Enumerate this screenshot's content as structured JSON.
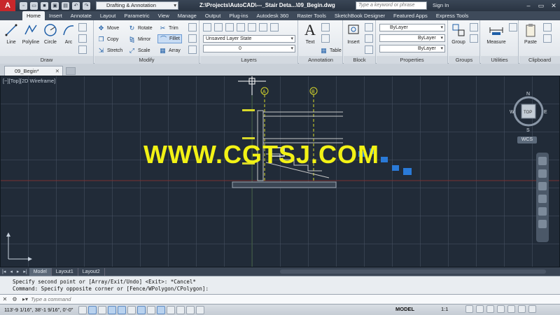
{
  "titlebar": {
    "app_logo": "A",
    "workspace": "Drafting & Annotation",
    "file_title": "Z:\\Projects\\AutoCAD\\---_Stair Deta...\\09_Begin.dwg",
    "search_placeholder": "Type a keyword or phrase",
    "signin": "Sign In"
  },
  "ribbon_tabs": [
    "Home",
    "Insert",
    "Annotate",
    "Layout",
    "Parametric",
    "View",
    "Manage",
    "Output",
    "Plug-ins",
    "Autodesk 360",
    "Raster Tools",
    "SketchBook Designer",
    "Featured Apps",
    "Express Tools"
  ],
  "draw": {
    "title": "Draw",
    "line": "Line",
    "polyline": "Polyline",
    "circle": "Circle",
    "arc": "Arc"
  },
  "modify": {
    "title": "Modify",
    "move": "Move",
    "rotate": "Rotate",
    "trim": "Trim",
    "copy": "Copy",
    "mirror": "Mirror",
    "fillet": "Fillet",
    "stretch": "Stretch",
    "scale": "Scale",
    "array": "Array"
  },
  "layers": {
    "title": "Layers",
    "layer_state": "Unsaved Layer State",
    "current_layer": "0"
  },
  "annotation": {
    "title": "Annotation",
    "text": "Text",
    "table": "Table"
  },
  "block": {
    "title": "Block",
    "insert": "Insert"
  },
  "properties": {
    "title": "Properties",
    "color": "ByLayer",
    "linetype": "ByLayer",
    "lineweight": "ByLayer"
  },
  "groups": {
    "title": "Groups",
    "group": "Group"
  },
  "utilities": {
    "title": "Utilities",
    "measure": "Measure"
  },
  "clipboard": {
    "title": "Clipboard",
    "paste": "Paste"
  },
  "doc_tab": "09_Begin*",
  "viewport_label": "[−][Top][2D Wireframe]",
  "viewcube": {
    "top": "TOP",
    "n": "N",
    "s": "S",
    "e": "E",
    "w": "W",
    "wcs": "WCS"
  },
  "drawing": {
    "grid_a": "A",
    "grid_b": "B"
  },
  "watermark": "WWW.CGTSJ.COM",
  "layout_tabs": [
    "Model",
    "Layout1",
    "Layout2"
  ],
  "command_history": [
    "Specify second point or [Array/Exit/Undo] <Exit>: *Cancel*",
    "Command: Specify opposite corner or [Fence/WPolygon/CPolygon]:"
  ],
  "command": {
    "placeholder": "Type a command"
  },
  "statusbar": {
    "coords": "113'-9 1/16\", 38'-1 9/16\", 0'-0\"",
    "model": "MODEL",
    "scale": "1:1"
  },
  "colors": {
    "canvas": "#212b38",
    "accent": "#1f5fa8",
    "watermark": "#f2f215",
    "logo": "#c8272b"
  }
}
